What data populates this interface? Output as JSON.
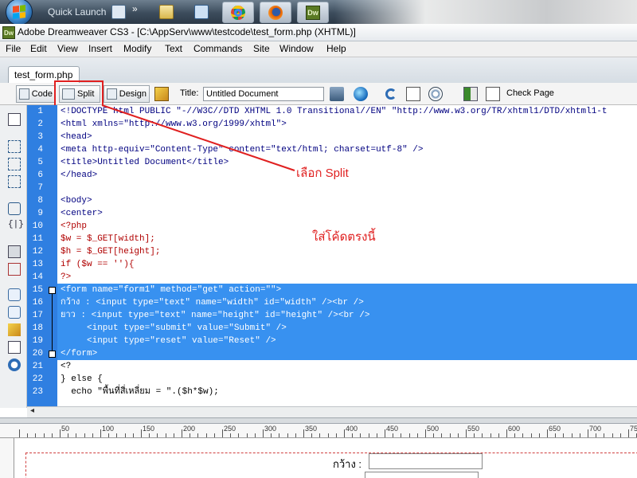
{
  "taskbar": {
    "quick_launch": "Quick Launch",
    "buttons": [
      "chrome",
      "firefox",
      "dreamweaver"
    ],
    "dw_label": "Dw"
  },
  "window": {
    "title": "Adobe Dreamweaver CS3 - [C:\\AppServ\\www\\testcode\\test_form.php (XHTML)]"
  },
  "menu": [
    "File",
    "Edit",
    "View",
    "Insert",
    "Modify",
    "Text",
    "Commands",
    "Site",
    "Window",
    "Help"
  ],
  "doc_tab": "test_form.php",
  "toolbar": {
    "code": "Code",
    "split": "Split",
    "design": "Design",
    "title_label": "Title:",
    "title_value": "Untitled Document",
    "check_page": "Check Page"
  },
  "code_lines": [
    {
      "n": "1",
      "t": "<!DOCTYPE html PUBLIC \"-//W3C//DTD XHTML 1.0 Transitional//EN\" \"http://www.w3.org/TR/xhtml1/DTD/xhtml1-t"
    },
    {
      "n": "2",
      "t": "<html xmlns=\"http://www.w3.org/1999/xhtml\">"
    },
    {
      "n": "3",
      "t": "<head>"
    },
    {
      "n": "4",
      "t": "<meta http-equiv=\"Content-Type\" content=\"text/html; charset=utf-8\" />"
    },
    {
      "n": "5",
      "t": "<title>Untitled Document</title>"
    },
    {
      "n": "6",
      "t": "</head>"
    },
    {
      "n": "7",
      "t": ""
    },
    {
      "n": "8",
      "t": "<body>"
    },
    {
      "n": "9",
      "t": "<center>"
    },
    {
      "n": "10",
      "t": "<?php"
    },
    {
      "n": "11",
      "t": "$w = $_GET[width];"
    },
    {
      "n": "12",
      "t": "$h = $_GET[height];"
    },
    {
      "n": "13",
      "t": "if ($w == ''){"
    },
    {
      "n": "14",
      "t": "?>"
    },
    {
      "n": "15",
      "t": "<form name=\"form1\" method=\"get\" action=\"\">"
    },
    {
      "n": "16",
      "t": "กว้าง : <input type=\"text\" name=\"width\" id=\"width\" /><br />"
    },
    {
      "n": "17",
      "t": "ยาว : <input type=\"text\" name=\"height\" id=\"height\" /><br />"
    },
    {
      "n": "18",
      "t": "     <input type=\"submit\" value=\"Submit\" />"
    },
    {
      "n": "19",
      "t": "     <input type=\"reset\" value=\"Reset\" />"
    },
    {
      "n": "20",
      "t": "</form>"
    },
    {
      "n": "21",
      "t": "<?"
    },
    {
      "n": "22",
      "t": "} else {"
    },
    {
      "n": "23",
      "t": "  echo \"พื้นที่สี่เหลี่ยม = \".($h*$w);"
    }
  ],
  "annotations": {
    "split_note": "เลือก Split",
    "code_note": "ใส่โค้ดตรงนี้"
  },
  "ruler_labels": [
    "50",
    "100",
    "150",
    "200",
    "250",
    "300",
    "350",
    "400",
    "450",
    "500",
    "550",
    "600",
    "650",
    "700",
    "750"
  ],
  "design_view": {
    "width_label": "กว้าง :"
  },
  "colors": {
    "selection": "#3891f0",
    "annotation": "#e02020",
    "gutter": "#2f7fe1"
  }
}
